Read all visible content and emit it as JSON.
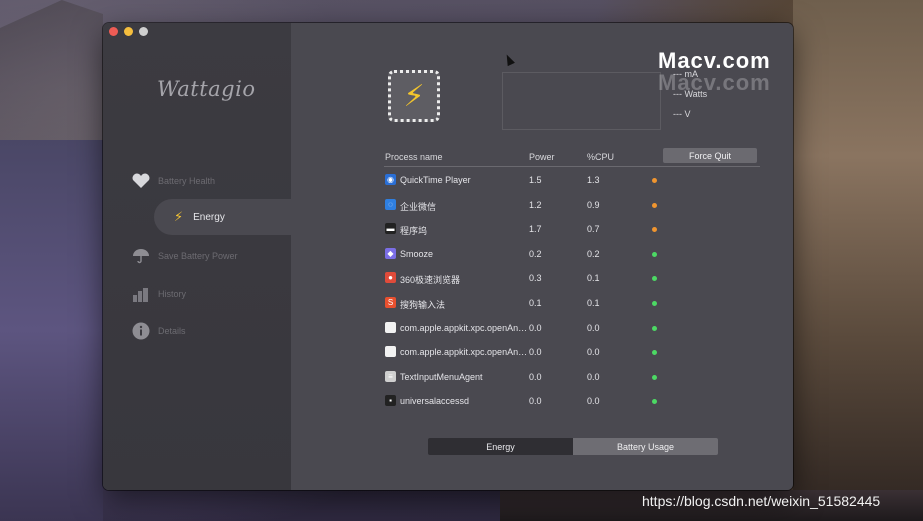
{
  "desktop": {
    "watermark_primary": "Macv.com",
    "watermark_echo": "Macv.com",
    "watermark_url": "https://blog.csdn.net/weixin_51582445"
  },
  "sidebar": {
    "logo": "Wattagio",
    "items": [
      {
        "label": "Battery Health",
        "icon": "heart-icon"
      },
      {
        "label": "Energy",
        "icon": "lightning-icon",
        "active": true
      },
      {
        "label": "Save Battery Power",
        "icon": "umbrella-icon"
      },
      {
        "label": "History",
        "icon": "history-bars-icon"
      },
      {
        "label": "Details",
        "icon": "info-icon"
      }
    ]
  },
  "readouts": {
    "ma": "--- mA",
    "watts": "--- Watts",
    "volts": "--- V"
  },
  "table": {
    "columns": [
      "Process name",
      "Power",
      "%CPU"
    ],
    "force_quit_label": "Force Quit",
    "rows": [
      {
        "name": "QuickTime Player",
        "power": "1.5",
        "cpu": "1.3",
        "status": "#f0952f",
        "icon": "quicktime-icon"
      },
      {
        "name": "企业微信",
        "power": "1.2",
        "cpu": "0.9",
        "status": "#f0952f",
        "icon": "wecom-icon"
      },
      {
        "name": "程序坞",
        "power": "1.7",
        "cpu": "0.7",
        "status": "#f0952f",
        "icon": "dock-icon"
      },
      {
        "name": "Smooze",
        "power": "0.2",
        "cpu": "0.2",
        "status": "#4cd964",
        "icon": "smooze-icon"
      },
      {
        "name": "360极速浏览器",
        "power": "0.3",
        "cpu": "0.1",
        "status": "#4cd964",
        "icon": "browser-360-icon"
      },
      {
        "name": "搜狗输入法",
        "power": "0.1",
        "cpu": "0.1",
        "status": "#4cd964",
        "icon": "sogou-icon"
      },
      {
        "name": "com.apple.appkit.xpc.openAndSavePanelService",
        "power": "0.0",
        "cpu": "0.0",
        "status": "#4cd964",
        "icon": "document-icon"
      },
      {
        "name": "com.apple.appkit.xpc.openAndSavePanelService",
        "power": "0.0",
        "cpu": "0.0",
        "status": "#4cd964",
        "icon": "document-icon"
      },
      {
        "name": "TextInputMenuAgent",
        "power": "0.0",
        "cpu": "0.0",
        "status": "#4cd964",
        "icon": "text-input-icon"
      },
      {
        "name": "universalaccessd",
        "power": "0.0",
        "cpu": "0.0",
        "status": "#4cd964",
        "icon": "terminal-icon"
      }
    ]
  },
  "segmented": {
    "energy": "Energy",
    "battery_usage": "Battery Usage"
  },
  "colors": {
    "accent_yellow": "#f4c62c",
    "status_orange": "#f0952f",
    "status_green": "#4cd964"
  }
}
